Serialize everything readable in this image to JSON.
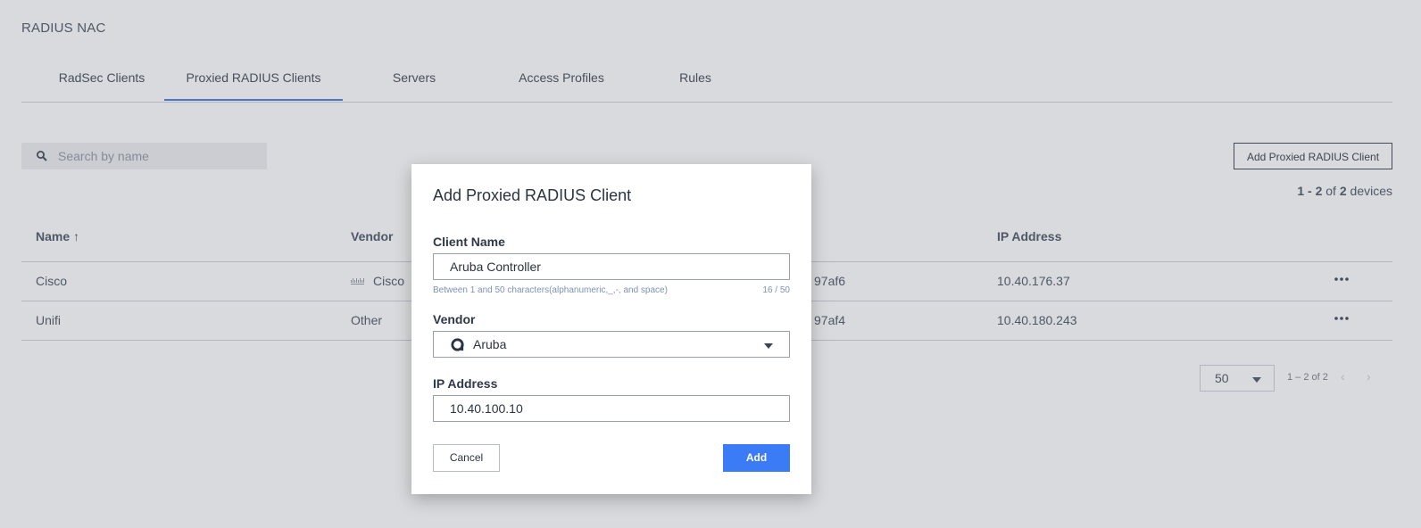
{
  "app": {
    "title": "RADIUS NAC"
  },
  "tabs": [
    {
      "label": "RadSec Clients",
      "active": false
    },
    {
      "label": "Proxied RADIUS Clients",
      "active": true
    },
    {
      "label": "Servers",
      "active": false
    },
    {
      "label": "Access Profiles",
      "active": false
    },
    {
      "label": "Rules",
      "active": false
    }
  ],
  "search": {
    "placeholder": "Search by name",
    "icon": "search-icon"
  },
  "toolbar": {
    "add_label": "Add Proxied RADIUS Client"
  },
  "device_count": {
    "start": "1",
    "sep1": " - ",
    "end": "2",
    "of": " of ",
    "total": "2",
    "suffix": " devices"
  },
  "table": {
    "headers": {
      "name": "Name",
      "sort_arrow": "↑",
      "vendor": "Vendor",
      "ip": "IP Address"
    },
    "rows": [
      {
        "name": "Cisco",
        "vendor": "Cisco",
        "vendor_icon": "cisco-logo-icon",
        "id_suffix": "97af6",
        "ip": "10.40.176.37"
      },
      {
        "name": "Unifi",
        "vendor": "Other",
        "id_suffix": "97af4",
        "ip": "10.40.180.243"
      }
    ]
  },
  "pagination": {
    "page_size": "50",
    "range": "1 – 2 of 2",
    "prev": "‹",
    "next": "›"
  },
  "modal": {
    "title": "Add Proxied RADIUS Client",
    "client_name": {
      "label": "Client Name",
      "value": "Aruba Controller",
      "hint": "Between 1 and 50 characters(alphanumeric,_,-, and space)",
      "counter": "16 / 50"
    },
    "vendor": {
      "label": "Vendor",
      "value": "Aruba",
      "icon": "aruba-logo-icon"
    },
    "ip_address": {
      "label": "IP Address",
      "value": "10.40.100.10"
    },
    "cancel_label": "Cancel",
    "add_label": "Add"
  },
  "colors": {
    "accent": "#3c7bf6",
    "tab_underline": "#3b6fd4",
    "text": "#2b3441",
    "hint": "#7d92b4"
  }
}
